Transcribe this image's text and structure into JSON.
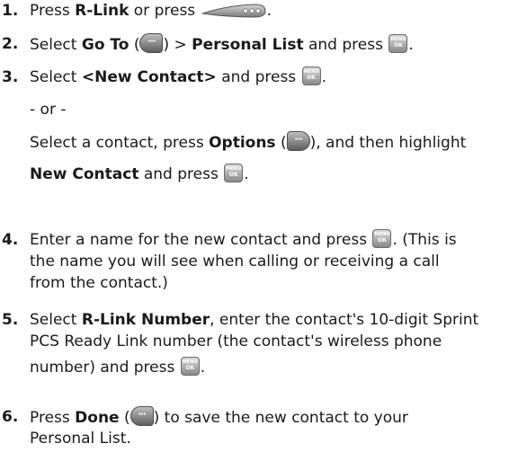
{
  "steps": [
    {
      "number": "1.",
      "lines": [
        {
          "t1": "Press ",
          "b1": "R-Link",
          "t2": " or press ",
          "t3": "."
        }
      ]
    },
    {
      "number": "2.",
      "lines": [
        {
          "t1": "Select ",
          "b1": "Go To",
          "t2": " (",
          "t3": ") > ",
          "b2": "Personal List",
          "t4": " and press ",
          "t5": "."
        }
      ]
    },
    {
      "number": "3.",
      "lines": [
        {
          "t1": "Select ",
          "b1": "<New Contact>",
          "t2": " and press ",
          "t3": "."
        },
        {
          "t1": "- or -"
        },
        {
          "t1": "Select a contact, press ",
          "b1": "Options",
          "t2": " (",
          "t3": "), and then highlight"
        },
        {
          "b1": "New Contact",
          "t1": " and press ",
          "t2": "."
        }
      ]
    },
    {
      "number": "4.",
      "lines": [
        {
          "t1": "Enter a name for the new contact and press ",
          "t2": ". (This is"
        },
        {
          "t1": "the name you will see when calling or receiving a call"
        },
        {
          "t1": "from the contact.)"
        }
      ]
    },
    {
      "number": "5.",
      "lines": [
        {
          "t1": "Select ",
          "b1": "R-Link Number",
          "t2": ", enter the contact's 10-digit Sprint"
        },
        {
          "t1": "PCS Ready Link number (the contact's wireless phone"
        },
        {
          "t1": "number) and press ",
          "t2": "."
        }
      ]
    },
    {
      "number": "6.",
      "lines": [
        {
          "t1": "Press ",
          "b1": "Done",
          "t2": " (",
          "t3": ") to save the new contact to your"
        },
        {
          "t1": "Personal List."
        }
      ]
    }
  ],
  "icons": {
    "menu_ok_top": "MENU",
    "menu_ok_bottom": "OK",
    "soft_key_glyph": "···"
  }
}
